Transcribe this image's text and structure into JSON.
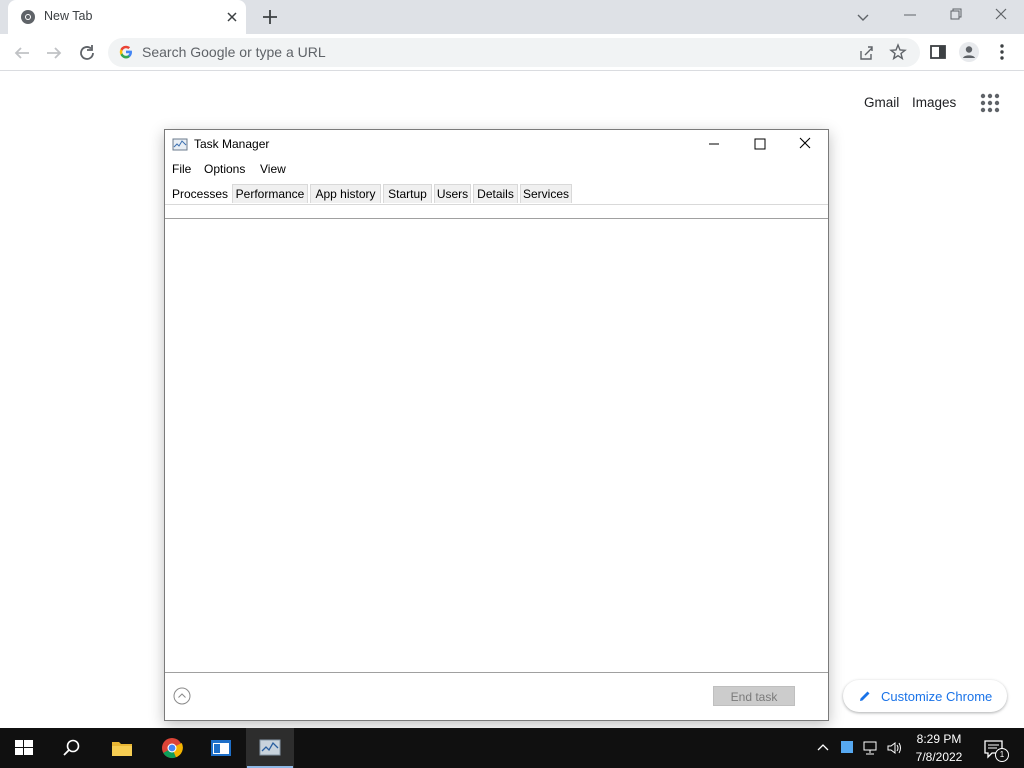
{
  "browser": {
    "tab": {
      "title": "New Tab"
    },
    "omnibox": {
      "placeholder": "Search Google or type a URL"
    },
    "accent_color": "#1a73e8"
  },
  "newtab_page": {
    "gmail_label": "Gmail",
    "images_label": "Images",
    "customize_label": "Customize Chrome"
  },
  "task_manager": {
    "title": "Task Manager",
    "menus": [
      "File",
      "Options",
      "View"
    ],
    "tabs": [
      {
        "label": "Processes",
        "active": true
      },
      {
        "label": "Performance",
        "active": false
      },
      {
        "label": "App history",
        "active": false
      },
      {
        "label": "Startup",
        "active": false
      },
      {
        "label": "Users",
        "active": false
      },
      {
        "label": "Details",
        "active": false
      },
      {
        "label": "Services",
        "active": false
      }
    ],
    "end_task_label": "End task"
  },
  "taskbar": {
    "apps": [
      "start-icon",
      "search-icon",
      "file-explorer-icon",
      "chrome-icon",
      "app-icon",
      "task-manager-icon"
    ],
    "clock": {
      "time": "8:29 PM",
      "date": "7/8/2022"
    },
    "notification_count": "1"
  }
}
